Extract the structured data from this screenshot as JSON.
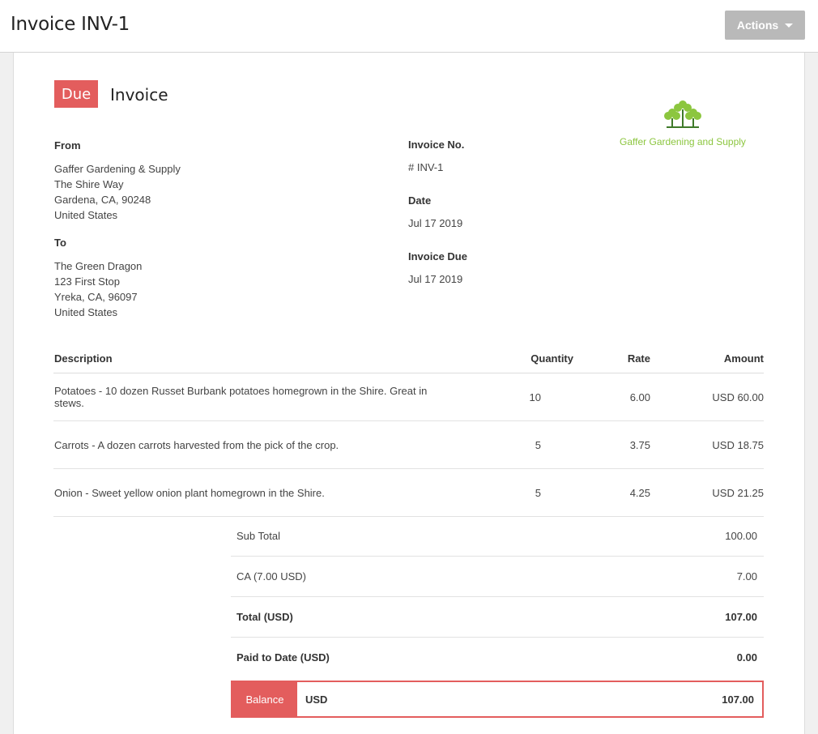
{
  "header": {
    "title": "Invoice INV-1",
    "actions_label": "Actions"
  },
  "invoice": {
    "status": "Due",
    "heading": "Invoice",
    "from_label": "From",
    "from": [
      "Gaffer Gardening & Supply",
      "The Shire Way",
      "Gardena, CA, 90248",
      "United States"
    ],
    "to_label": "To",
    "to": [
      "The Green Dragon",
      "123 First Stop",
      "Yreka, CA, 96097",
      "United States"
    ],
    "number_label": "Invoice No.",
    "number": "# INV-1",
    "date_label": "Date",
    "date": "Jul 17 2019",
    "due_label": "Invoice Due",
    "due": "Jul 17 2019",
    "logo_text": "Gaffer Gardening and Supply",
    "logo_icon": "trees-logo-icon",
    "accent": "#e35d5d",
    "logo_color": "#8cc63f"
  },
  "items": {
    "headers": {
      "description": "Description",
      "quantity": "Quantity",
      "rate": "Rate",
      "amount": "Amount"
    },
    "rows": [
      {
        "description": "Potatoes - 10 dozen Russet Burbank potatoes homegrown in the Shire. Great in stews.",
        "quantity": "10",
        "rate": "6.00",
        "amount": "USD 60.00"
      },
      {
        "description": "Carrots - A dozen carrots harvested from the pick of the crop.",
        "quantity": "5",
        "rate": "3.75",
        "amount": "USD 18.75"
      },
      {
        "description": "Onion - Sweet yellow onion plant homegrown in the Shire.",
        "quantity": "5",
        "rate": "4.25",
        "amount": "USD 21.25"
      }
    ]
  },
  "totals": {
    "subtotal_label": "Sub Total",
    "subtotal": "100.00",
    "tax_label": "CA (7.00 USD)",
    "tax": "7.00",
    "total_label": "Total (USD)",
    "total": "107.00",
    "paid_label": "Paid to Date (USD)",
    "paid": "0.00",
    "balance_label": "Balance",
    "balance_currency": "USD",
    "balance": "107.00"
  }
}
